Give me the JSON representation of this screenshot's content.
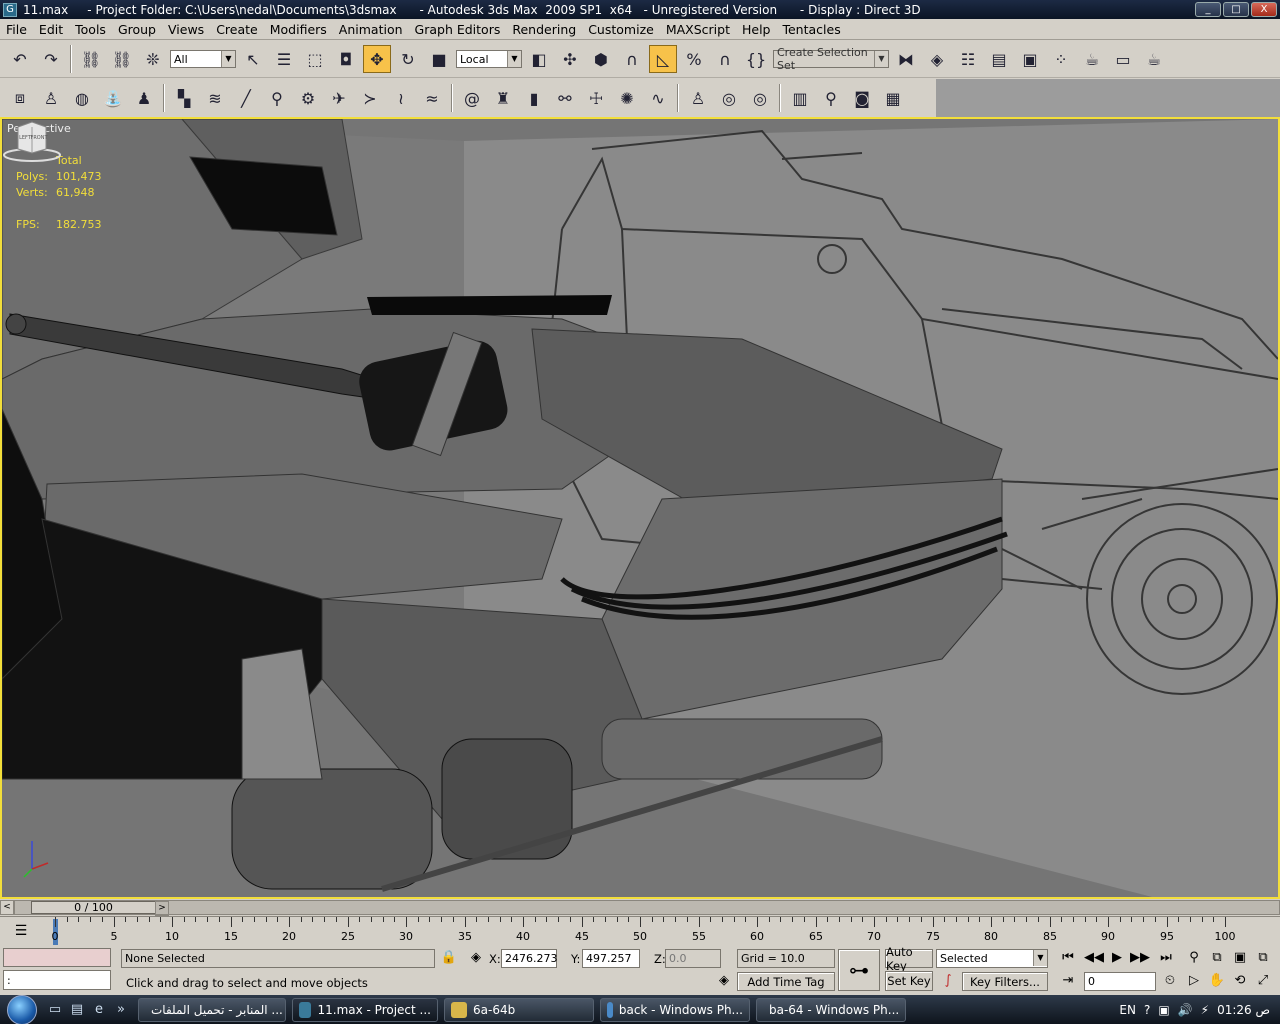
{
  "titlebar": {
    "title": "11.max     - Project Folder: C:\\Users\\nedal\\Documents\\3dsmax      - Autodesk 3ds Max  2009 SP1  x64   - Unregistered Version      - Display : Direct 3D",
    "minimize": "_",
    "maximize": "□",
    "close": "X"
  },
  "menubar": {
    "items": [
      "File",
      "Edit",
      "Tools",
      "Group",
      "Views",
      "Create",
      "Modifiers",
      "Animation",
      "Graph Editors",
      "Rendering",
      "Customize",
      "MAXScript",
      "Help",
      "Tentacles"
    ]
  },
  "toolbar_main": {
    "filter_value": "All",
    "coord_value": "Local",
    "selection_set_placeholder": "Create Selection Set"
  },
  "viewport": {
    "label": "Perspective",
    "stats": {
      "header": "Total",
      "polys_label": "Polys:",
      "polys_value": "101,473",
      "verts_label": "Verts:",
      "verts_value": "61,948",
      "fps_label": "FPS:",
      "fps_value": "182.753"
    },
    "viewcube": {
      "left": "LEFT",
      "front": "FRONT"
    },
    "colors": {
      "border": "#f2de3a",
      "stats": "#f2de3a",
      "background": "#757575"
    }
  },
  "timeslider": {
    "position": "0 / 100",
    "prev": "<",
    "next": ">"
  },
  "ruler": {
    "labels": [
      "0",
      "5",
      "10",
      "15",
      "20",
      "25",
      "30",
      "35",
      "40",
      "45",
      "50",
      "55",
      "60",
      "65",
      "70",
      "75",
      "80",
      "85",
      "90",
      "95",
      "100"
    ]
  },
  "status": {
    "selection_text": "None Selected",
    "prompt_text": "Click and drag to select and move objects",
    "maxscript_prompt": ":",
    "x_label": "X:",
    "x_value": "2476.273",
    "y_label": "Y:",
    "y_value": "497.257",
    "z_label": "Z:",
    "z_value": "0.0",
    "grid_text": "Grid = 10.0",
    "add_time_tag": "Add Time Tag",
    "auto_key": "Auto Key",
    "set_key": "Set Key",
    "key_mode_value": "Selected",
    "key_filters": "Key Filters...",
    "frame_value": "0"
  },
  "taskbar": {
    "tasks": [
      {
        "label": "المنابر - تحميل الملفات ...",
        "icon": "firefox-icon"
      },
      {
        "label": "11.max     - Project ...",
        "icon": "3dsmax-icon"
      },
      {
        "label": "6a-64b",
        "icon": "folder-icon"
      },
      {
        "label": "back - Windows Ph...",
        "icon": "photo-viewer-icon"
      },
      {
        "label": "ba-64 - Windows Ph...",
        "icon": "photo-viewer-icon"
      }
    ],
    "language": "EN",
    "clock": "01:26 ص"
  }
}
